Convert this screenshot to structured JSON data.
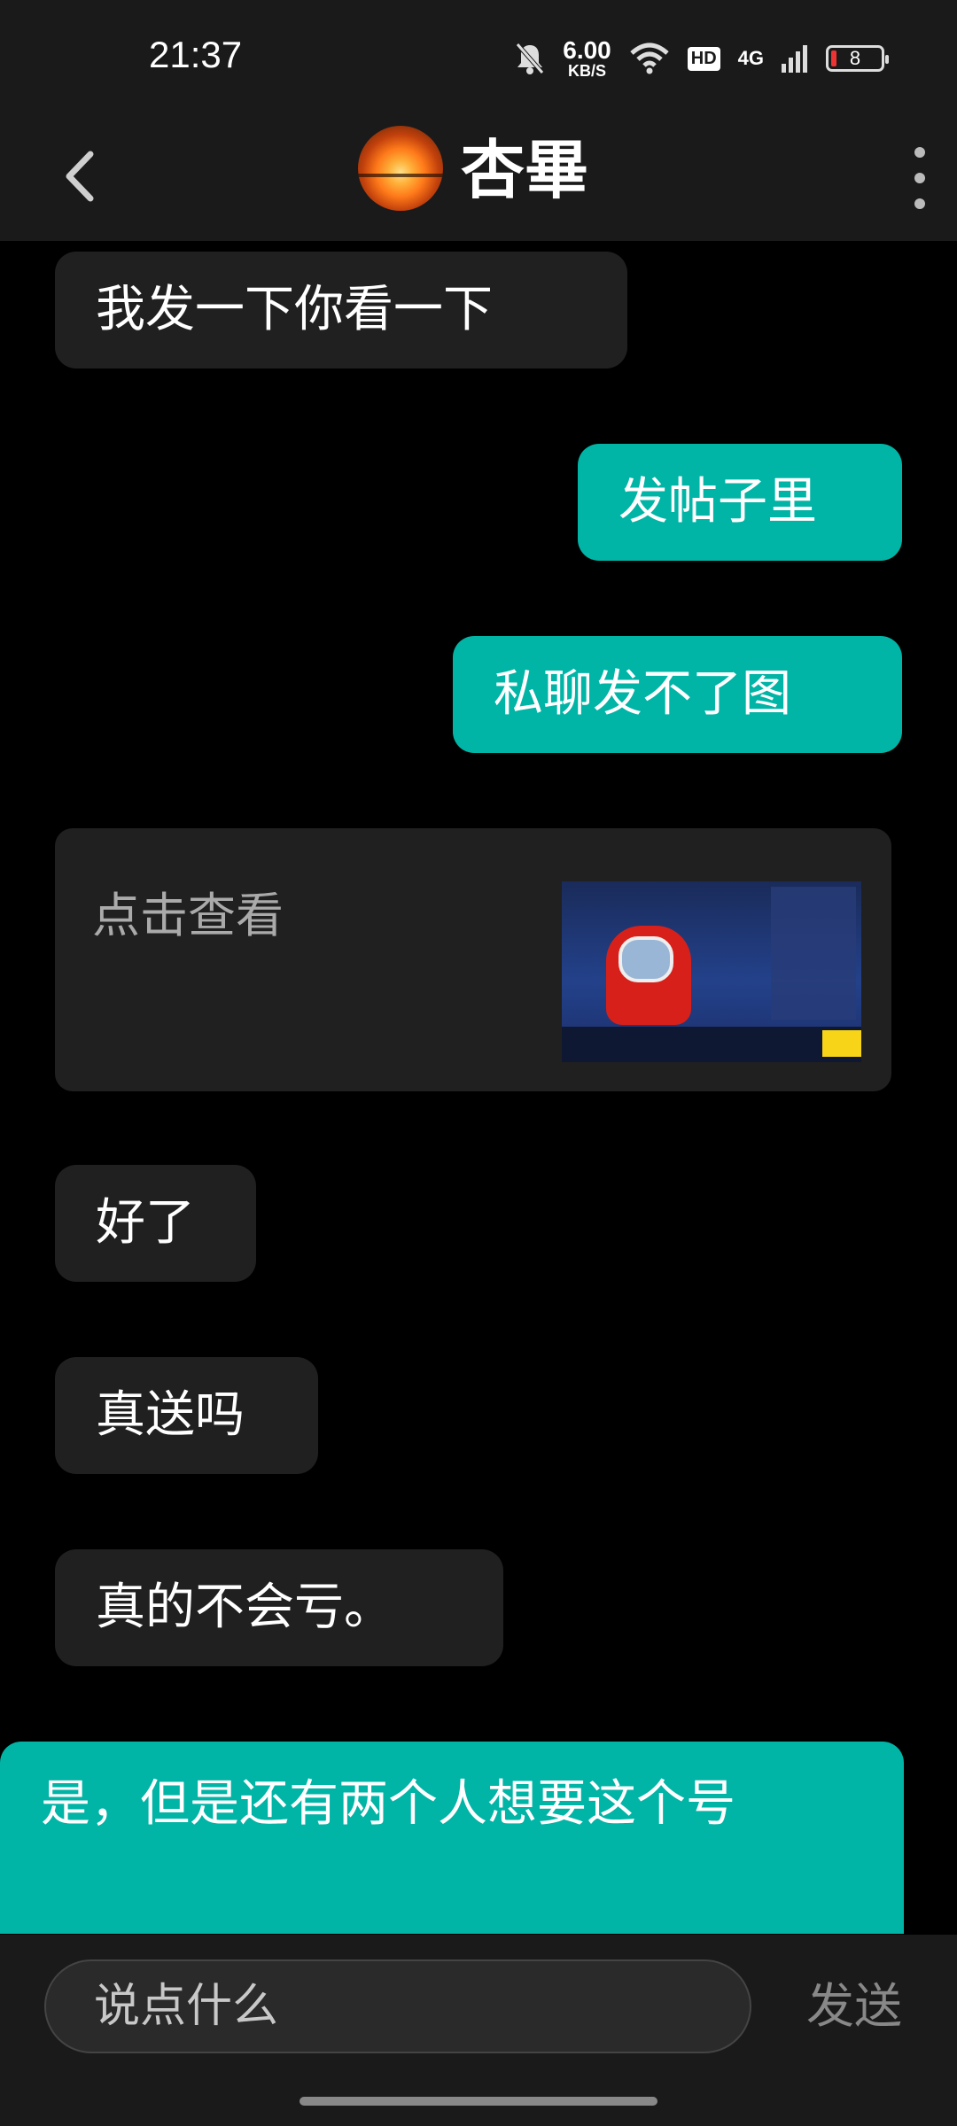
{
  "status_bar": {
    "time": "21:37",
    "net_speed_value": "6.00",
    "net_speed_unit": "KB/S",
    "hd_badge": "HD",
    "network_type": "4G",
    "battery_level": "8",
    "icons": [
      "mute-bell-icon",
      "wifi-icon",
      "signal-icon",
      "battery-icon"
    ]
  },
  "header": {
    "contact_name": "杏畢",
    "avatar": "sunset-avatar",
    "icons": [
      "back-icon",
      "more-icon"
    ]
  },
  "messages": [
    {
      "side": "incoming",
      "text": "我发一下你看一下"
    },
    {
      "side": "outgoing",
      "text": "发帖子里"
    },
    {
      "side": "outgoing",
      "text": "私聊发不了图"
    },
    {
      "side": "incoming",
      "type": "link-card",
      "text": "点击查看",
      "thumbnail": "game-screenshot-thumbnail"
    },
    {
      "side": "incoming",
      "text": "好了"
    },
    {
      "side": "incoming",
      "text": "真送吗"
    },
    {
      "side": "incoming",
      "text": "真的不会亏。"
    },
    {
      "side": "outgoing",
      "text": "是，但是还有两个人想要这个号"
    }
  ],
  "composer": {
    "placeholder": "说点什么",
    "send_label": "发送"
  },
  "colors": {
    "outgoing_bubble": "#00b4a6",
    "incoming_bubble": "#202020",
    "background": "#000000",
    "bars": "#1a1a1a"
  }
}
